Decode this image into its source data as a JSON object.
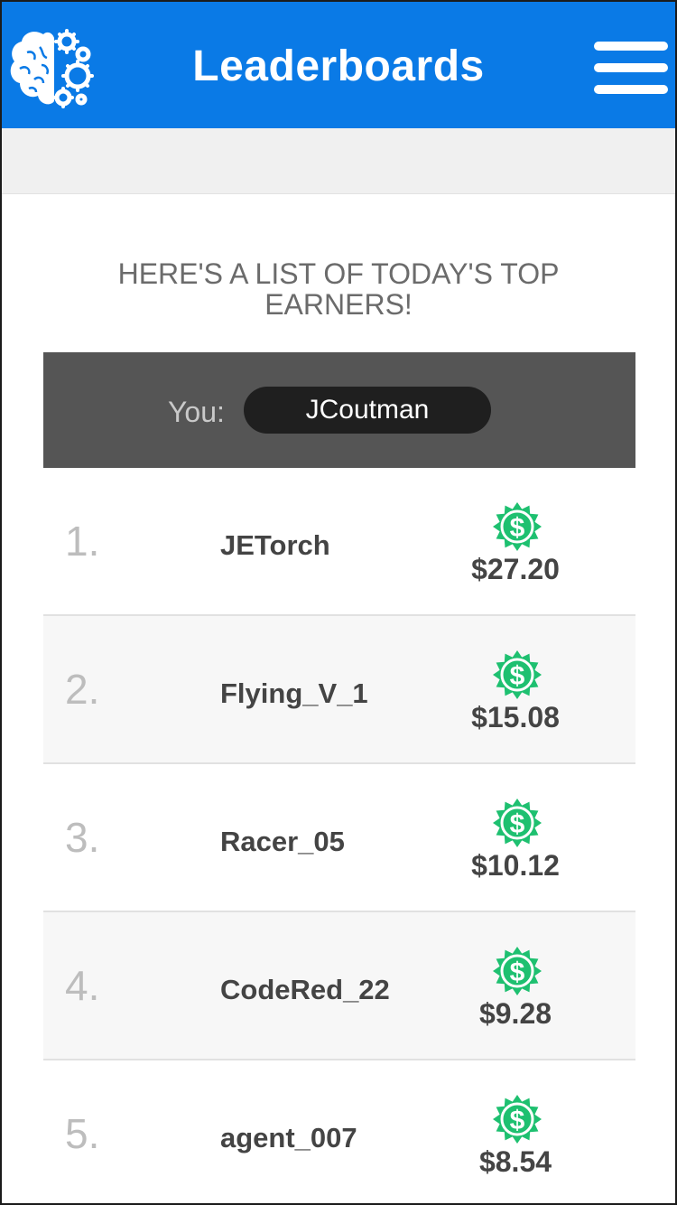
{
  "header": {
    "title": "Leaderboards",
    "logo_icon": "brain-gears-icon",
    "menu_icon": "hamburger-menu-icon"
  },
  "intro": {
    "text": "HERE'S A LIST OF TODAY'S TOP EARNERS!"
  },
  "you": {
    "label": "You:",
    "name": "JCoutman"
  },
  "colors": {
    "header_bg": "#0a7ae6",
    "badge": "#1ec070",
    "you_bar": "#555555"
  },
  "leaderboard": [
    {
      "rank": "1.",
      "name": "JETorch",
      "amount": "$27.20",
      "icon": "dollar-badge-icon"
    },
    {
      "rank": "2.",
      "name": "Flying_V_1",
      "amount": "$15.08",
      "icon": "dollar-badge-icon"
    },
    {
      "rank": "3.",
      "name": "Racer_05",
      "amount": "$10.12",
      "icon": "dollar-badge-icon"
    },
    {
      "rank": "4.",
      "name": "CodeRed_22",
      "amount": "$9.28",
      "icon": "dollar-badge-icon"
    },
    {
      "rank": "5.",
      "name": "agent_007",
      "amount": "$8.54",
      "icon": "dollar-badge-icon"
    }
  ]
}
